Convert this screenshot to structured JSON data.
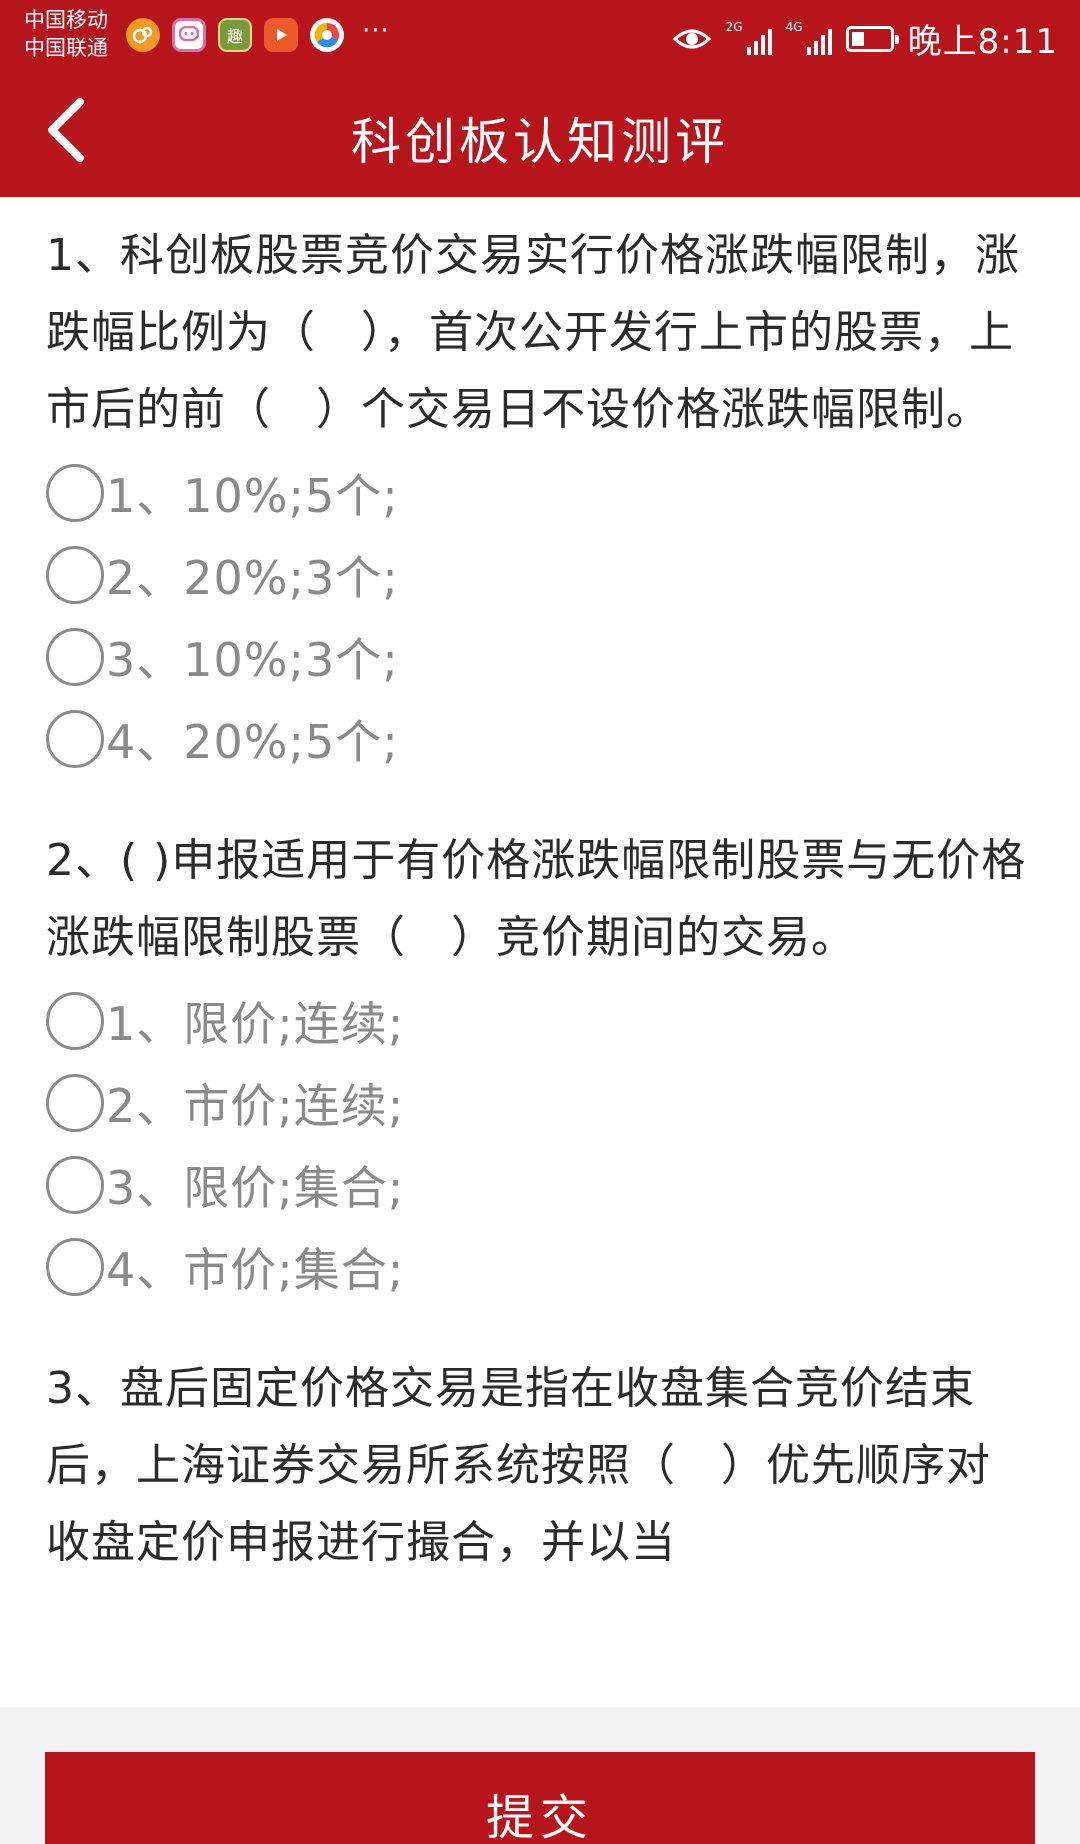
{
  "status_bar": {
    "carrier_1": "中国移动",
    "carrier_2": "中国联通",
    "app_icons": [
      "weibo-like-icon",
      "chat-bubble-icon",
      "qu-app-icon",
      "video-play-icon",
      "browser-icon"
    ],
    "app_icon_2_glyph": "趣",
    "more": "···",
    "sim1_tag": "2G",
    "sim2_tag": "4G",
    "time": "晚上8:11"
  },
  "header": {
    "title": "科创板认知测评",
    "back_icon": "chevron-left-icon"
  },
  "colors": {
    "brand_red": "#b5151b",
    "text_dark": "#2b2b2b",
    "option_gray": "#8a8a8a",
    "bottom_bg": "#f2f2f2"
  },
  "questions": [
    {
      "text": "1、科创板股票竞价交易实行价格涨跌幅限制，涨跌幅比例为（　），首次公开发行上市的股票，上市后的前（　）个交易日不设价格涨跌幅限制。",
      "options": [
        "1、10%;5个;",
        "2、20%;3个;",
        "3、10%;3个;",
        "4、20%;5个;"
      ]
    },
    {
      "text": "2、( )申报适用于有价格涨跌幅限制股票与无价格涨跌幅限制股票（　）竞价期间的交易。",
      "options": [
        "1、限价;连续;",
        "2、市价;连续;",
        "3、限价;集合;",
        "4、市价;集合;"
      ]
    },
    {
      "text": "3、盘后固定价格交易是指在收盘集合竞价结束后，上海证券交易所系统按照（　）优先顺序对收盘定价申报进行撮合，并以当",
      "options": []
    }
  ],
  "footer": {
    "submit_label": "提交"
  }
}
